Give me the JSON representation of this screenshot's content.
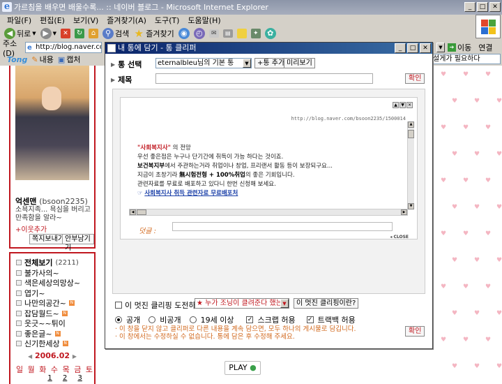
{
  "browser": {
    "title": "가르침을 배우면 배울수록... :: 네이버 블로그 - Microsoft Internet Explorer",
    "menu": [
      "파일(F)",
      "편집(E)",
      "보기(V)",
      "즐겨찾기(A)",
      "도구(T)",
      "도움말(H)"
    ],
    "toolbar": {
      "back": "뒤로",
      "search": "검색",
      "favorites": "즐겨찾기"
    },
    "address_label": "주소(D)",
    "address": "http://blog.naver.com/",
    "go": "이동",
    "links": "연결",
    "linkbar": {
      "logo": "Tong",
      "mine": "내용",
      "scrap": "캡처",
      "right_select": "설게가 필요하다"
    }
  },
  "blog": {
    "profile": {
      "name": "억센맨",
      "id": "(bsoon2235)",
      "desc": "소욕지족... 욕심을 버리고 만족함을 알라~",
      "add": "+이웃추가",
      "btn_message": "쪽지보내기",
      "btn_guest": "안부남기기"
    },
    "categories": {
      "total_label": "전체보기",
      "total_count": "(2211)",
      "items": [
        {
          "label": "불가사의~",
          "new": ""
        },
        {
          "label": "색은세상의망상~",
          "new": ""
        },
        {
          "label": "엽기~",
          "new": ""
        },
        {
          "label": "나만의공간~",
          "new": "N"
        },
        {
          "label": "잡담월드~",
          "new": "N"
        },
        {
          "label": "웃긋~~튀이",
          "new": ""
        },
        {
          "label": "좋은글~",
          "new": "N"
        },
        {
          "label": "신기한세상",
          "new": "N"
        }
      ]
    },
    "calendar": {
      "month": "2006.02",
      "weekdays": [
        "일",
        "월",
        "화",
        "수",
        "목",
        "금",
        "토"
      ],
      "days": [
        "",
        "",
        "",
        "1",
        "2",
        "3",
        ""
      ]
    },
    "play": "PLAY"
  },
  "popup": {
    "title": "내 통에 담기 - 통 클리퍼",
    "board_label": "통 선택",
    "board_value": "eternalbleu님의 기본 통",
    "add_board": "+통 추가",
    "preview": "미리보기",
    "title_label": "제목",
    "confirm": "확인",
    "clip": {
      "url": "http://blog.naver.com/bsoon2235/1500014",
      "heading_quote": "\"사회복지사\"",
      "heading_rest": "의 전망",
      "line1": "우선 좋은점은 누구나 단기간에 취득이 가능 하다는 것이죠.",
      "line2_b": "보건복지부",
      "line2_rest": "에서 주관하는거라 취업이나 창업, 프리랜서 활동 등이 보장되구요...",
      "line3_a": "지금이 초창기라",
      "line3_b": "無시험전형 + 100%취업",
      "line3_rest": "의 좋은 기회입니다.",
      "line4": "관련자료를 무료로 배포하고 있다니 한번 신청해 보세요.",
      "link": "사회복지사 취득 관련자료 무료배포처",
      "comment_label": "덧글 :",
      "close": "CLOSE"
    },
    "challenge": "이 멋진 클리핑 도전하기",
    "who_select": "누가 조닝이 클려준다 했는가?",
    "what_btn": "이 멋진 클리핑이란?",
    "privacy": {
      "public": "공개",
      "private": "비공개",
      "adult": "19세 이상"
    },
    "scrap_allow": "스크랩 허용",
    "trackback_allow": "트랙백 허용",
    "note1": "· 이 창을 닫지 않고 클리퍼로 다른 내용을 계속 담으면, 모두 하나의 게시물로 담깁니다.",
    "note2": "· 이 창에서는 수정하실 수 없습니다. 통에 담은 후 수정해 주세요."
  },
  "colors": {
    "accent": "#c0171f",
    "title_bar": "#0a246a",
    "note": "#d2691e"
  }
}
